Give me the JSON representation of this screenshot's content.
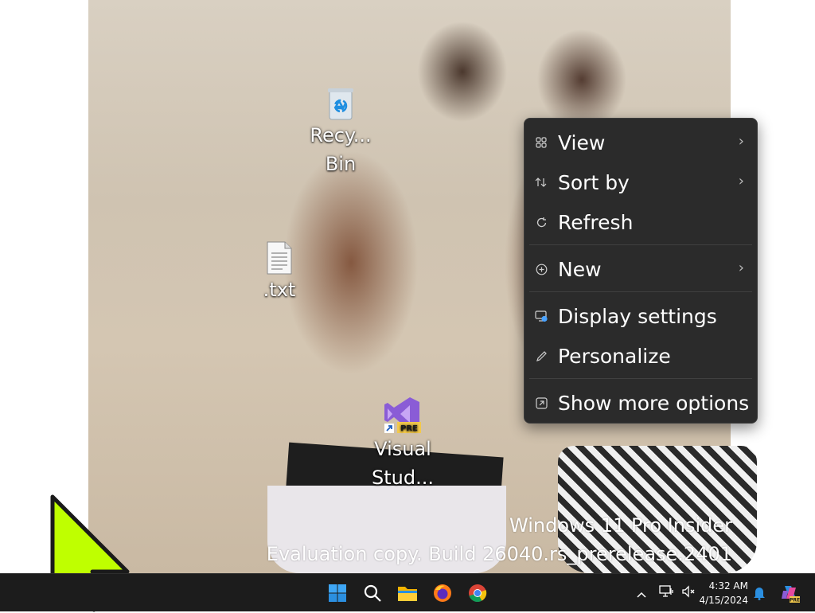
{
  "desktop": {
    "icons": [
      {
        "name": "recycle-bin",
        "lines": [
          "Recy...",
          "Bin"
        ]
      },
      {
        "name": "txt-file",
        "lines": [
          ".txt"
        ]
      },
      {
        "name": "visual-studio",
        "lines": [
          "Visual",
          "Stud..."
        ],
        "badge": "PRE"
      }
    ],
    "watermark": {
      "line1": "Windows 11 Pro Insider",
      "line2": "Evaluation copy. Build 26040.rs_prerelease.2401"
    }
  },
  "context_menu": {
    "items": [
      {
        "label": "View",
        "icon": "grid-icon",
        "submenu": true
      },
      {
        "label": "Sort by",
        "icon": "sort-icon",
        "submenu": true
      },
      {
        "label": "Refresh",
        "icon": "refresh-icon",
        "submenu": false
      },
      {
        "label": "New",
        "icon": "plus-circle-icon",
        "submenu": true
      },
      {
        "label": "Display settings",
        "icon": "display-icon",
        "submenu": false
      },
      {
        "label": "Personalize",
        "icon": "pen-icon",
        "submenu": false
      },
      {
        "label": "Show more options",
        "icon": "expand-icon",
        "submenu": false
      }
    ],
    "submenu_arrow": "›"
  },
  "taskbar": {
    "apps": [
      "start-icon",
      "search-icon",
      "file-explorer-icon",
      "firefox-icon",
      "chrome-icon"
    ],
    "tray": {
      "time": "4:32 AM",
      "date": "4/15/2024",
      "copilot_badge": "PRE"
    }
  },
  "colors": {
    "menu_bg": "#2b2b2b",
    "taskbar_bg": "#1c1c1c",
    "cursor": "#bfff00",
    "vs_purple": "#8a5cd6",
    "pre_badge": "#f2c94c"
  }
}
